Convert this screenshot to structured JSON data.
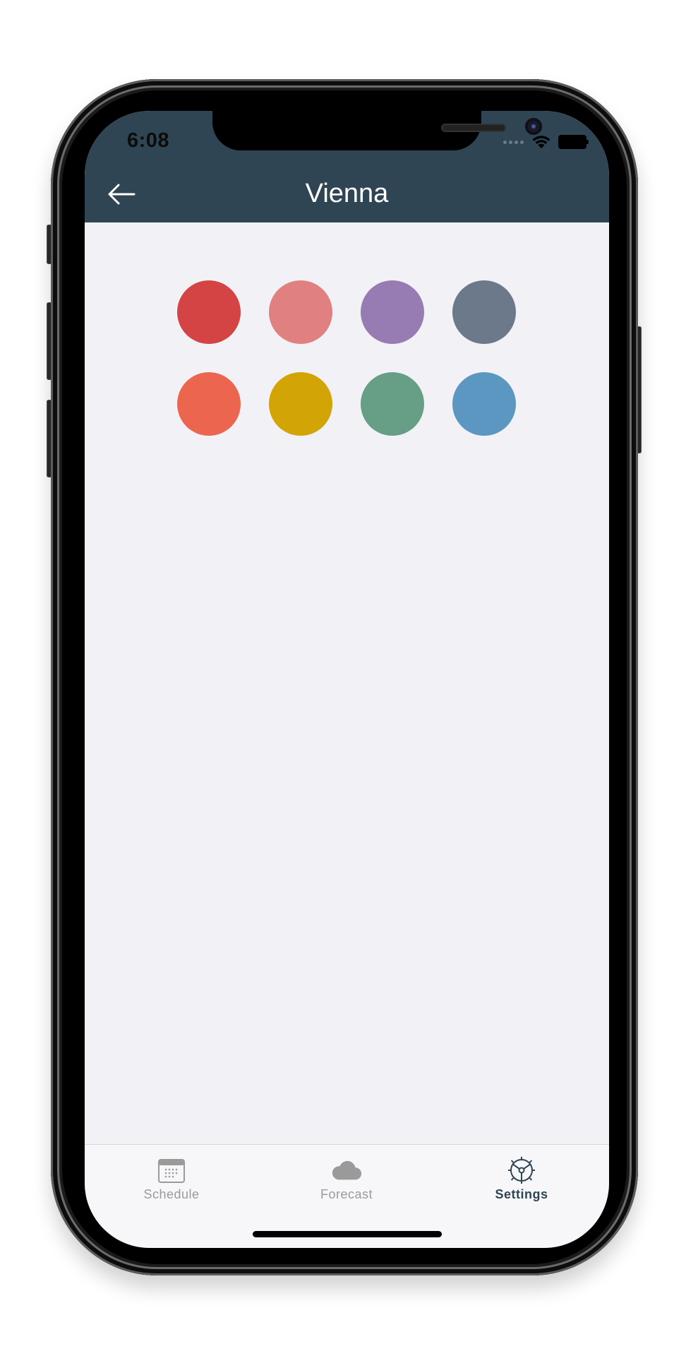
{
  "status_bar": {
    "time": "6:08",
    "icons": [
      "cellular-dots-icon",
      "wifi-icon",
      "battery-icon"
    ]
  },
  "header": {
    "title": "Vienna",
    "back_icon": "arrow-left-icon",
    "background": "#2f4554"
  },
  "color_swatches": [
    {
      "name": "red",
      "color": "#d54444"
    },
    {
      "name": "pink",
      "color": "#e08081"
    },
    {
      "name": "purple",
      "color": "#967cb2"
    },
    {
      "name": "slate",
      "color": "#6c798a"
    },
    {
      "name": "orange",
      "color": "#ec664f"
    },
    {
      "name": "gold",
      "color": "#d2a405"
    },
    {
      "name": "green",
      "color": "#679f86"
    },
    {
      "name": "blue",
      "color": "#5b97c0"
    }
  ],
  "tab_bar": {
    "tabs": [
      {
        "label": "Schedule",
        "icon": "calendar-icon",
        "active": false
      },
      {
        "label": "Forecast",
        "icon": "cloud-icon",
        "active": false
      },
      {
        "label": "Settings",
        "icon": "steering-wheel-icon",
        "active": true
      }
    ],
    "active_color": "#2f4554",
    "inactive_color": "#9a9a9a"
  }
}
